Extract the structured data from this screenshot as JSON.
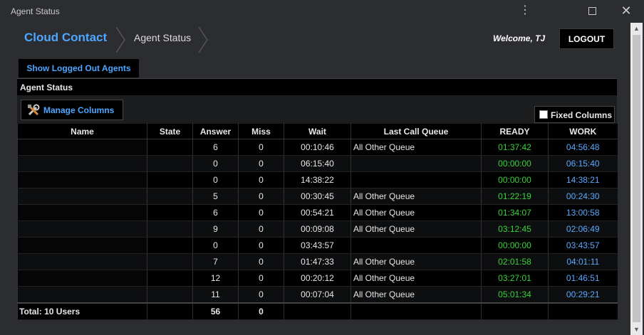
{
  "window": {
    "title": "Agent Status",
    "menu_icon": "more-vertical-icon",
    "maximize_icon": "maximize-icon",
    "close_icon": "close-icon"
  },
  "header": {
    "brand": "Cloud Contact",
    "breadcrumb": "Agent Status",
    "welcome": "Welcome, TJ",
    "logout_label": "LOGOUT"
  },
  "tabs": {
    "logged_out_label": "Show Logged Out Agents"
  },
  "panel": {
    "title": "Agent Status"
  },
  "toolbar": {
    "manage_columns_label": "Manage Columns",
    "fixed_columns_label": "Fixed Columns",
    "fixed_columns_checked": false
  },
  "colors": {
    "accent": "#4da6ff",
    "ready": "#39d339",
    "work": "#5aa9ff"
  },
  "table": {
    "columns": [
      "Name",
      "State",
      "Answer",
      "Miss",
      "Wait",
      "Last Call Queue",
      "READY",
      "WORK"
    ],
    "rows": [
      {
        "name": "",
        "state": "",
        "answer": "6",
        "miss": "0",
        "wait": "00:10:46",
        "queue": "All Other Queue",
        "ready": "01:37:42",
        "work": "04:56:48"
      },
      {
        "name": "",
        "state": "",
        "answer": "0",
        "miss": "0",
        "wait": "06:15:40",
        "queue": "",
        "ready": "00:00:00",
        "work": "06:15:40"
      },
      {
        "name": "",
        "state": "",
        "answer": "0",
        "miss": "0",
        "wait": "14:38:22",
        "queue": "",
        "ready": "00:00:00",
        "work": "14:38:21"
      },
      {
        "name": "",
        "state": "",
        "answer": "5",
        "miss": "0",
        "wait": "00:30:45",
        "queue": "All Other Queue",
        "ready": "01:22:19",
        "work": "00:24:30"
      },
      {
        "name": "",
        "state": "",
        "answer": "6",
        "miss": "0",
        "wait": "00:54:21",
        "queue": "All Other Queue",
        "ready": "01:34:07",
        "work": "13:00:58"
      },
      {
        "name": "",
        "state": "",
        "answer": "9",
        "miss": "0",
        "wait": "00:09:08",
        "queue": "All Other Queue",
        "ready": "03:12:45",
        "work": "02:06:49"
      },
      {
        "name": "",
        "state": "",
        "answer": "0",
        "miss": "0",
        "wait": "03:43:57",
        "queue": "",
        "ready": "00:00:00",
        "work": "03:43:57"
      },
      {
        "name": "",
        "state": "",
        "answer": "7",
        "miss": "0",
        "wait": "01:47:33",
        "queue": "All Other Queue",
        "ready": "02:01:58",
        "work": "04:01:11"
      },
      {
        "name": "",
        "state": "",
        "answer": "12",
        "miss": "0",
        "wait": "00:20:12",
        "queue": "All Other Queue",
        "ready": "03:27:01",
        "work": "01:46:51"
      },
      {
        "name": "",
        "state": "",
        "answer": "11",
        "miss": "0",
        "wait": "00:07:04",
        "queue": "All Other Queue",
        "ready": "05:01:34",
        "work": "00:29:21"
      }
    ],
    "totals": {
      "label": "Total: 10 Users",
      "answer": "56",
      "miss": "0"
    }
  }
}
